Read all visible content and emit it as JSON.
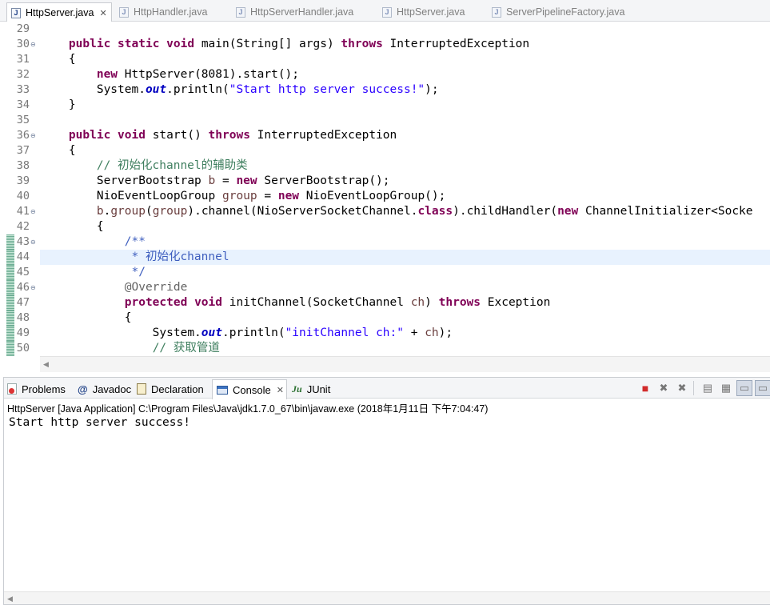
{
  "editor_tabs": [
    {
      "label": "HttpServer.java",
      "active": true,
      "closable": true,
      "icon": "java-file-icon"
    },
    {
      "label": "HttpHandler.java",
      "active": false,
      "icon": "java-file-icon"
    },
    {
      "label": "HttpServerHandler.java",
      "active": false,
      "icon": "java-file-icon"
    },
    {
      "label": "HttpServer.java",
      "active": false,
      "icon": "java-file-icon"
    },
    {
      "label": "ServerPipelineFactory.java",
      "active": false,
      "icon": "java-file-icon"
    }
  ],
  "editor": {
    "current_line": "44",
    "lines": [
      {
        "num": "29",
        "text": ""
      },
      {
        "num": "30",
        "fold": true,
        "text": "    public static void main(String[] args) throws InterruptedException"
      },
      {
        "num": "31",
        "text": "    {"
      },
      {
        "num": "32",
        "text": "        new HttpServer(8081).start();"
      },
      {
        "num": "33",
        "text": "        System.out.println(\"Start http server success!\");"
      },
      {
        "num": "34",
        "text": "    }"
      },
      {
        "num": "35",
        "text": ""
      },
      {
        "num": "36",
        "fold": true,
        "text": "    public void start() throws InterruptedException"
      },
      {
        "num": "37",
        "text": "    {"
      },
      {
        "num": "38",
        "text": "        // 初始化channel的辅助类"
      },
      {
        "num": "39",
        "text": "        ServerBootstrap b = new ServerBootstrap();"
      },
      {
        "num": "40",
        "text": "        NioEventLoopGroup group = new NioEventLoopGroup();"
      },
      {
        "num": "41",
        "fold": true,
        "text": "        b.group(group).channel(NioServerSocketChannel.class).childHandler(new ChannelInitializer<Socke"
      },
      {
        "num": "42",
        "text": "        {"
      },
      {
        "num": "43",
        "fold": true,
        "text": "            /**"
      },
      {
        "num": "44",
        "text": "             * 初始化channel"
      },
      {
        "num": "45",
        "text": "             */"
      },
      {
        "num": "46",
        "fold": true,
        "text": "            @Override"
      },
      {
        "num": "47",
        "text": "            protected void initChannel(SocketChannel ch) throws Exception"
      },
      {
        "num": "48",
        "text": "            {"
      },
      {
        "num": "49",
        "text": "                System.out.println(\"initChannel ch:\" + ch);"
      },
      {
        "num": "50",
        "text": "                // 获取管道"
      }
    ]
  },
  "view_tabs": [
    {
      "label": "Problems",
      "icon": "problems-icon",
      "active": false
    },
    {
      "label": "Javadoc",
      "icon": "javadoc-at-icon",
      "active": false
    },
    {
      "label": "Declaration",
      "icon": "declaration-icon",
      "active": false
    },
    {
      "label": "Console",
      "icon": "console-icon",
      "active": true,
      "closable": true
    },
    {
      "label": "JUnit",
      "icon": "junit-icon",
      "active": false
    }
  ],
  "console": {
    "launch_info": "HttpServer [Java Application] C:\\Program Files\\Java\\jdk1.7.0_67\\bin\\javaw.exe (2018年1月11日 下午7:04:47)",
    "output": "Start http server success!"
  },
  "colors": {
    "keyword": "#7f0055",
    "string": "#2a00ff",
    "comment": "#3f7f5f",
    "javadoc": "#3f5fbf",
    "static_field": "#0000c0",
    "current_line": "#e8f2fe",
    "terminate": "#d12b2b"
  }
}
